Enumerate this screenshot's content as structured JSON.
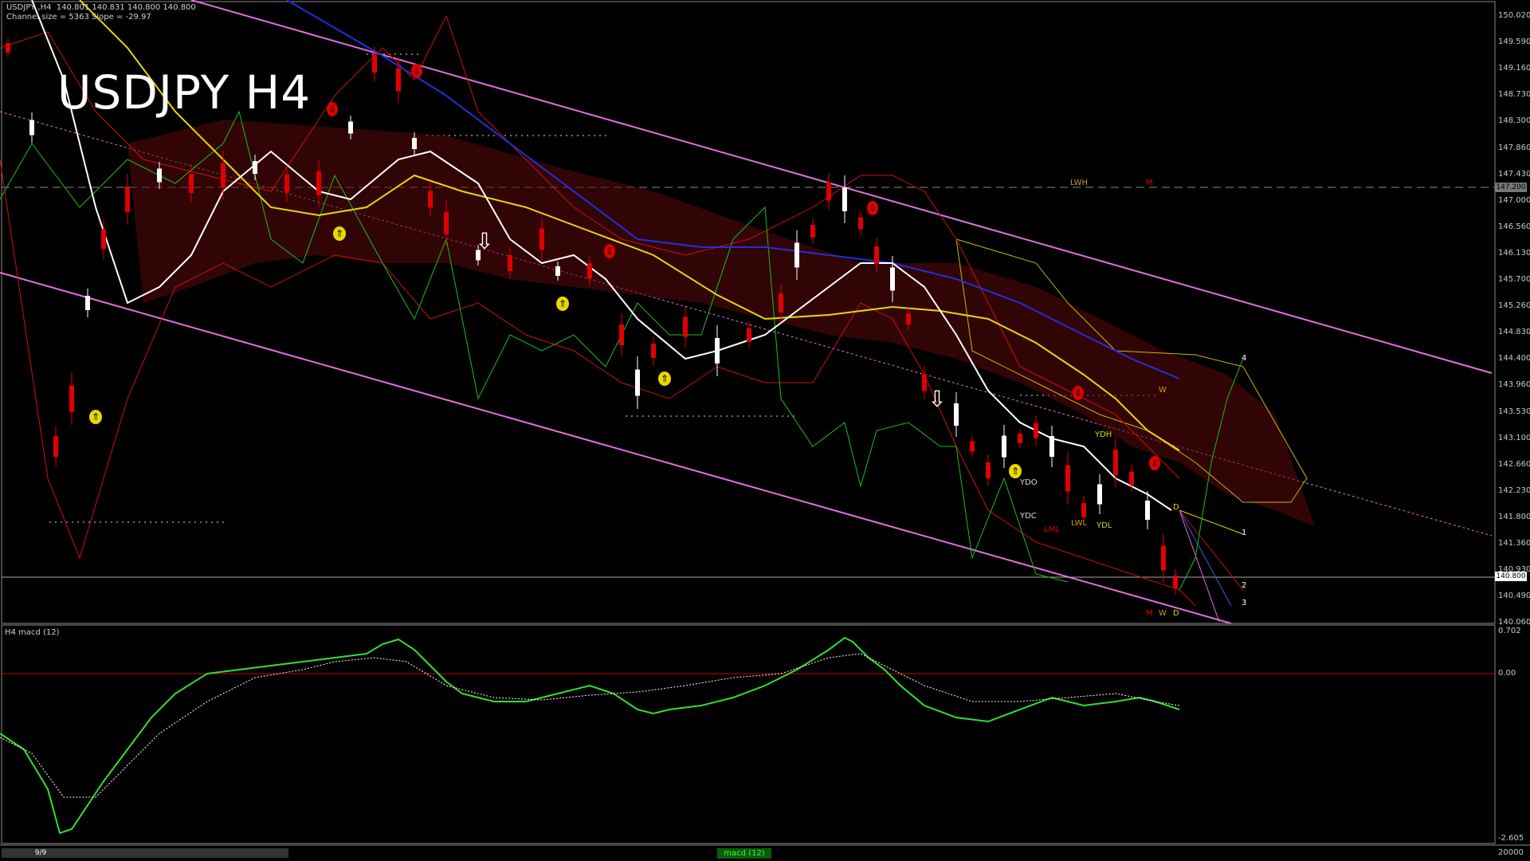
{
  "header": {
    "info_line1": "USDJPY ,H4  140.801 140.831 140.800 140.800",
    "info_line2": "Channel size = 5363 Slope = -29.97",
    "big_title": "USDJPY H4"
  },
  "indicator": {
    "label": "H4  macd (12)"
  },
  "price_axis": {
    "ticks": [
      "150.020",
      "149.590",
      "149.160",
      "148.730",
      "148.300",
      "147.860",
      "147.430",
      "147.000",
      "146.560",
      "146.130",
      "145.700",
      "145.260",
      "144.830",
      "144.400",
      "143.960",
      "143.530",
      "143.100",
      "142.660",
      "142.230",
      "141.800",
      "141.360",
      "140.930",
      "140.490",
      "140.060"
    ],
    "current_price": "140.800",
    "hline_price": "147.200"
  },
  "macd_axis": {
    "ticks": [
      "0.702",
      "0.00",
      "-2.605"
    ]
  },
  "annotations": {
    "lwh": "LWH",
    "m_top": "M",
    "w_right": "W",
    "ydh": "YDH",
    "ydo": "YDO",
    "ydc": "YDC",
    "lml": "LML",
    "lwl": "LWL",
    "ydl": "YDL",
    "d_upper": "D",
    "bottom_m": "M",
    "bottom_w": "W",
    "bottom_d": "D",
    "proj_4": "4",
    "proj_1": "1",
    "proj_2": "2",
    "proj_3": "3"
  },
  "bottom_bar": {
    "page_indicator": "9/9",
    "tab_label": "macd (12)",
    "right_value": "20000"
  },
  "colors": {
    "background": "#000000",
    "channel": "#e070e0",
    "ma_white": "#ffffff",
    "ma_yellow": "#e8d800",
    "ma_blue": "#2030e0",
    "bollinger": "#cc1010",
    "ichimoku": "#c8b800",
    "chikou": "#18c018",
    "bull_candle": "#ffffff",
    "bear_candle": "#e00000",
    "macd_up": "#30e030",
    "macd_down": "#e06a8a"
  },
  "arrows": [
    {
      "kind": "down-red",
      "label": "sell-signal"
    },
    {
      "kind": "up-yellow",
      "label": "buy-signal"
    },
    {
      "kind": "down-white",
      "label": "hollow-sell"
    }
  ]
}
